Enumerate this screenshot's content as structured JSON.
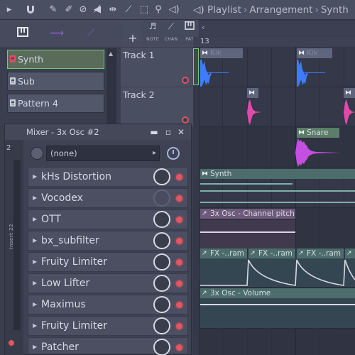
{
  "breadcrumb": {
    "app": "Playlist",
    "section": "Arrangement",
    "current": "Synth"
  },
  "note_strip": {
    "labels": [
      "NOTE",
      "CHAN",
      "PAT"
    ]
  },
  "ruler": {
    "bar": "13"
  },
  "channels": [
    {
      "label": "Synth",
      "selected": true
    },
    {
      "label": "Sub",
      "selected": false
    },
    {
      "label": "Pattern 4",
      "selected": false
    }
  ],
  "tracks": [
    {
      "label": "Track 1"
    },
    {
      "label": "Track 2"
    }
  ],
  "clips": {
    "kik_a": "Kik",
    "kik_b": "Kik",
    "snare": "Snare",
    "synth": "Synth",
    "channel_pitch": "3x Osc - Channel pitch",
    "fx_1": "FX -..ram Y",
    "fx_2": "FX -..ram Y",
    "fx_3": "FX -..ram Y",
    "volume": "3x Osc - Volume"
  },
  "mixer": {
    "title": "Mixer - 3x Osc #2",
    "track_number": "2",
    "track_name": "Insert 22",
    "preset": "(none)",
    "slots": [
      {
        "name": "kHs Distortion",
        "knob_active": true
      },
      {
        "name": "Vocodex",
        "knob_active": false
      },
      {
        "name": "OTT",
        "knob_active": true
      },
      {
        "name": "bx_subfilter",
        "knob_active": true
      },
      {
        "name": "Fruity Limiter",
        "knob_active": true
      },
      {
        "name": "Low Lifter",
        "knob_active": true
      },
      {
        "name": "Maximus",
        "knob_active": true
      },
      {
        "name": "Fruity Limiter",
        "knob_active": true
      },
      {
        "name": "Patcher",
        "knob_active": true
      }
    ]
  },
  "colors": {
    "kick_wave": "#3f7bff",
    "snare_wave": "#e04aa8",
    "snare_clip": "#c44fe0",
    "automation": "#d6d9e3",
    "accent_green": "#7cc47c",
    "led_red": "#e25561"
  }
}
